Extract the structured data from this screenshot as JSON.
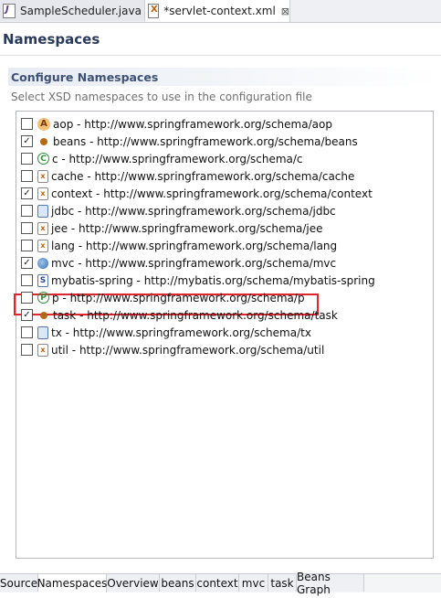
{
  "editor_tabs": [
    {
      "label": "SampleScheduler.java",
      "icon": "java-file-icon"
    },
    {
      "label": "*servlet-context.xml",
      "icon": "xml-file-icon",
      "close": "⊠"
    }
  ],
  "page_title": "Namespaces",
  "section": {
    "title": "Configure Namespaces",
    "description": "Select XSD namespaces to use in the configuration file"
  },
  "namespaces": [
    {
      "label": "aop - http://www.springframework.org/schema/aop",
      "checked": false,
      "icon": "aop-icon"
    },
    {
      "label": "beans - http://www.springframework.org/schema/beans",
      "checked": true,
      "icon": "bean-icon"
    },
    {
      "label": "c - http://www.springframework.org/schema/c",
      "checked": false,
      "icon": "c-namespace-icon"
    },
    {
      "label": "cache - http://www.springframework.org/schema/cache",
      "checked": false,
      "icon": "cache-icon"
    },
    {
      "label": "context - http://www.springframework.org/schema/context",
      "checked": true,
      "icon": "context-icon"
    },
    {
      "label": "jdbc - http://www.springframework.org/schema/jdbc",
      "checked": false,
      "icon": "jdbc-icon"
    },
    {
      "label": "jee - http://www.springframework.org/schema/jee",
      "checked": false,
      "icon": "jee-icon"
    },
    {
      "label": "lang - http://www.springframework.org/schema/lang",
      "checked": false,
      "icon": "lang-icon"
    },
    {
      "label": "mvc - http://www.springframework.org/schema/mvc",
      "checked": true,
      "icon": "mvc-globe-icon"
    },
    {
      "label": "mybatis-spring - http://mybatis.org/schema/mybatis-spring",
      "checked": false,
      "icon": "mybatis-schema-icon"
    },
    {
      "label": "p - http://www.springframework.org/schema/p",
      "checked": false,
      "icon": "p-namespace-icon"
    },
    {
      "label": "task - http://www.springframework.org/schema/task",
      "checked": true,
      "icon": "task-icon"
    },
    {
      "label": "tx - http://www.springframework.org/schema/tx",
      "checked": false,
      "icon": "tx-icon"
    },
    {
      "label": "util - http://www.springframework.org/schema/util",
      "checked": false,
      "icon": "util-icon"
    }
  ],
  "highlight_color": "#e0262c",
  "bottom_tabs": [
    {
      "label": "Source",
      "active": false
    },
    {
      "label": "Namespaces",
      "active": true
    },
    {
      "label": "Overview",
      "active": false
    },
    {
      "label": "beans",
      "active": false
    },
    {
      "label": "context",
      "active": false
    },
    {
      "label": "mvc",
      "active": false
    },
    {
      "label": "task",
      "active": false
    },
    {
      "label": "Beans Graph",
      "active": false
    }
  ]
}
